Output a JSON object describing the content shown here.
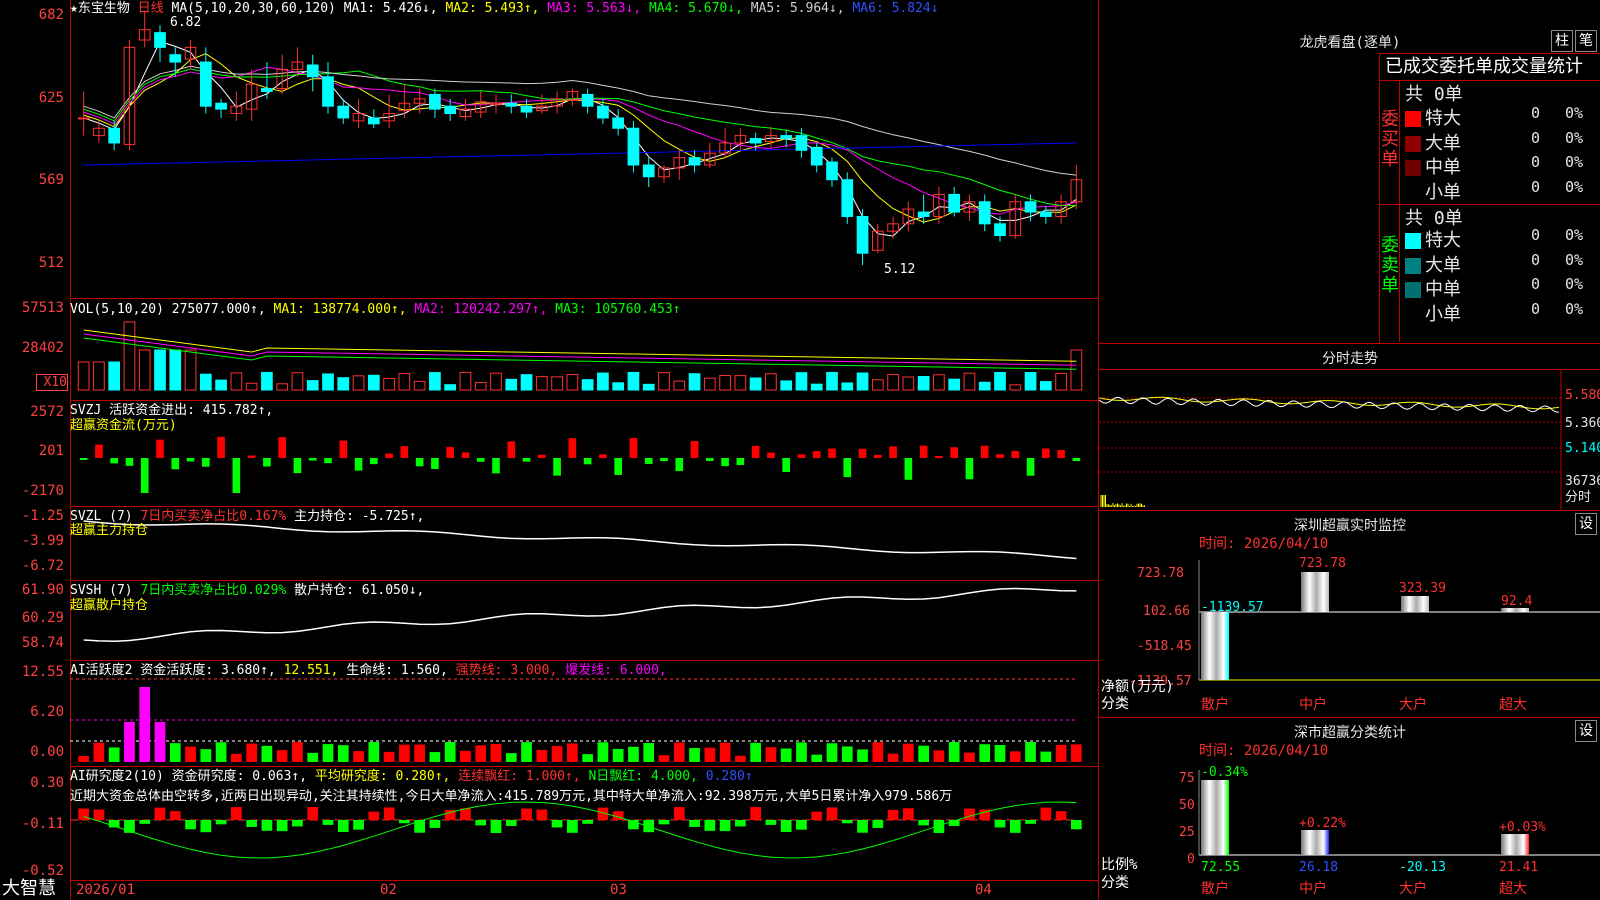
{
  "colors": {
    "up": "#ff3030",
    "down": "#00ffff",
    "bg": "#000000",
    "grid": "#c00000",
    "ma1": "#ffffff",
    "ma2": "#ffff00",
    "ma3": "#ff00ff",
    "ma4": "#00ff00",
    "ma5": "#d0d0d0",
    "ma6": "#0000ff",
    "green": "#00ff00",
    "magenta": "#ff00ff",
    "yellow": "#ffff00"
  },
  "left_axis": {
    "price": [
      "682",
      "625",
      "569",
      "512"
    ],
    "vol": [
      "57513",
      "28402"
    ],
    "vol_unit": "X10",
    "svzj": [
      "2572",
      "201",
      "-2170"
    ],
    "svzl": [
      "-1.25",
      "-3.99",
      "-6.72"
    ],
    "svsh": [
      "61.90",
      "60.29",
      "58.74"
    ],
    "ai1": [
      "12.55",
      "6.20",
      "0.00"
    ],
    "ai2": [
      "0.30",
      "-0.11",
      "-0.52"
    ]
  },
  "price_header": {
    "star": "★",
    "name": "东宝生物",
    "period": "日线",
    "ma_label": "MA(5,10,20,30,60,120)",
    "ma1": "MA1: 5.426↓,",
    "ma2": "MA2: 5.493↑,",
    "ma3": "MA3: 5.563↓,",
    "ma4": "MA4: 5.670↓,",
    "ma5": "MA5: 5.964↓,",
    "ma6": "MA6: 5.824↓",
    "high_mark": "6.82",
    "low_mark": "5.12"
  },
  "vol_header": {
    "label": "VOL(5,10,20)",
    "val": "275077.000↑,",
    "ma1": "MA1: 138774.000↑,",
    "ma2": "MA2: 120242.297↑,",
    "ma3": "MA3: 105760.453↑"
  },
  "svzj_header": {
    "label": "SVZJ",
    "val": "活跃资金进出: 415.782↑,",
    "sub": "超赢资金流(万元)"
  },
  "svzl_header": {
    "label": "SVZL (7)",
    "green": "7日内买卖净占比0.167%",
    "val": "主力持仓: -5.725↑,",
    "sub": "超赢主力持仓"
  },
  "svsh_header": {
    "label": "SVSH (7)",
    "green": "7日内买卖净占比0.029%",
    "val": "散户持仓: 61.050↓,",
    "sub": "超赢散户持仓"
  },
  "ai1_header": {
    "label": "AI活跃度2",
    "val": "资金活跃度: 3.680↑,",
    "v2": "12.551,",
    "v3": "生命线: 1.560,",
    "v4": "强势线: 3.000,",
    "v5": "爆发线: 6.000,"
  },
  "ai2_header": {
    "label": "AI研究度2(10)",
    "val": "资金研究度: 0.063↑,",
    "v2": "平均研究度: 0.280↑,",
    "v3": "连续飘红: 1.000↑,",
    "v4": "N日飘红: 4.000,",
    "v5": "0.280↑"
  },
  "ai2_comment": "近期大资金总体由空转多,近两日出现异动,关注其持续性,今日大单净流入:415.789万元,其中特大单净流入:92.398万元,大单5日累计净入979.586万",
  "date_axis": {
    "brand": "大智慧",
    "labels": [
      "2026/01",
      "02",
      "03",
      "04"
    ]
  },
  "right": {
    "dragon_title": "龙虎看盘(逐单)",
    "btn_zhu": "柱",
    "btn_bi": "笔",
    "stat_title": "已成交委托单成交量统计",
    "buy_total": "共 0单",
    "buy_side": "委买单",
    "sell_total": "共 0单",
    "sell_side": "委卖单",
    "rows": [
      {
        "label": "特大",
        "v": "0",
        "p": "0%"
      },
      {
        "label": "大单",
        "v": "0",
        "p": "0%"
      },
      {
        "label": "中单",
        "v": "0",
        "p": "0%"
      },
      {
        "label": "小单",
        "v": "0",
        "p": "0%"
      }
    ],
    "srows": [
      {
        "label": "特大",
        "v": "0",
        "p": "0%"
      },
      {
        "label": "大单",
        "v": "0",
        "p": "0%"
      },
      {
        "label": "中单",
        "v": "0",
        "p": "0%"
      },
      {
        "label": "小单",
        "v": "0",
        "p": "0%"
      }
    ],
    "timeline_title": "分时走势",
    "timeline_axis": [
      "5.580",
      "5.360",
      "5.140",
      "36736"
    ],
    "timeline_unit": "分时",
    "monitor_title": "深圳超赢实时监控",
    "monitor_time": "时间: 2026/04/10",
    "monitor_btn": "设",
    "monitor_axis": [
      "723.78",
      "102.66",
      "-518.45",
      "-1139.57"
    ],
    "monitor_values": [
      "-1139.57",
      "723.78",
      "323.39",
      "92.4"
    ],
    "monitor_ylabel": "净额(万元)",
    "monitor_xlabel": "分类",
    "monitor_cats": [
      "散户",
      "中户",
      "大户",
      "超大"
    ],
    "class_title": "深市超赢分类统计",
    "class_time": "时间: 2026/04/10",
    "class_btn": "设",
    "class_axis": [
      "75",
      "50",
      "25",
      "0"
    ],
    "class_top": [
      "-0.34%",
      "+0.22%",
      "",
      "+0.03%"
    ],
    "class_bottom": [
      "72.55",
      "26.18",
      "-20.13",
      "21.41"
    ],
    "class_ylabel": "比例%",
    "class_xlabel": "分类",
    "class_cats": [
      "散户",
      "中户",
      "大户",
      "超大"
    ]
  },
  "chart_data": {
    "type": "candlestick",
    "candles": [
      [
        612,
        612,
        630,
        600
      ],
      [
        600,
        605,
        610,
        595
      ],
      [
        605,
        595,
        610,
        590
      ],
      [
        594,
        660,
        665,
        590
      ],
      [
        665,
        672,
        685,
        660
      ],
      [
        670,
        660,
        675,
        650
      ],
      [
        655,
        650,
        660,
        640
      ],
      [
        652,
        660,
        665,
        645
      ],
      [
        650,
        620,
        660,
        615
      ],
      [
        622,
        618,
        625,
        612
      ],
      [
        615,
        620,
        630,
        610
      ],
      [
        618,
        635,
        645,
        610
      ],
      [
        632,
        630,
        650,
        625
      ],
      [
        632,
        645,
        655,
        628
      ],
      [
        645,
        650,
        660,
        640
      ],
      [
        648,
        640,
        655,
        630
      ],
      [
        640,
        620,
        650,
        615
      ],
      [
        620,
        612,
        625,
        608
      ],
      [
        610,
        615,
        625,
        605
      ],
      [
        612,
        608,
        618,
        605
      ],
      [
        610,
        615,
        628,
        605
      ],
      [
        617,
        622,
        635,
        612
      ],
      [
        622,
        625,
        632,
        615
      ],
      [
        628,
        618,
        632,
        612
      ],
      [
        620,
        615,
        625,
        610
      ],
      [
        613,
        618,
        625,
        610
      ],
      [
        616,
        623,
        630,
        612
      ],
      [
        621,
        622,
        628,
        615
      ],
      [
        622,
        620,
        628,
        615
      ],
      [
        620,
        616,
        625,
        612
      ],
      [
        617,
        620,
        628,
        615
      ],
      [
        620,
        625,
        630,
        615
      ],
      [
        624,
        630,
        632,
        620
      ],
      [
        628,
        620,
        632,
        615
      ],
      [
        620,
        612,
        625,
        608
      ],
      [
        612,
        605,
        618,
        600
      ],
      [
        605,
        580,
        610,
        575
      ],
      [
        580,
        572,
        585,
        565
      ],
      [
        572,
        578,
        580,
        568
      ],
      [
        578,
        585,
        590,
        570
      ],
      [
        585,
        580,
        590,
        575
      ],
      [
        580,
        588,
        595,
        578
      ],
      [
        588,
        595,
        605,
        585
      ],
      [
        595,
        600,
        605,
        590
      ],
      [
        598,
        595,
        602,
        590
      ],
      [
        596,
        600,
        606,
        592
      ],
      [
        600,
        598,
        604,
        592
      ],
      [
        600,
        590,
        605,
        585
      ],
      [
        592,
        580,
        595,
        575
      ],
      [
        582,
        570,
        585,
        565
      ],
      [
        570,
        545,
        575,
        540
      ],
      [
        545,
        520,
        550,
        512
      ],
      [
        522,
        535,
        540,
        520
      ],
      [
        535,
        540,
        545,
        530
      ],
      [
        540,
        550,
        555,
        535
      ],
      [
        548,
        545,
        560,
        540
      ],
      [
        545,
        560,
        565,
        540
      ],
      [
        560,
        548,
        565,
        545
      ],
      [
        548,
        555,
        560,
        542
      ],
      [
        555,
        540,
        560,
        535
      ],
      [
        540,
        532,
        545,
        528
      ],
      [
        532,
        555,
        560,
        530
      ],
      [
        555,
        548,
        560,
        542
      ],
      [
        548,
        545,
        552,
        540
      ],
      [
        545,
        555,
        560,
        540
      ],
      [
        555,
        570,
        580,
        550
      ]
    ]
  }
}
